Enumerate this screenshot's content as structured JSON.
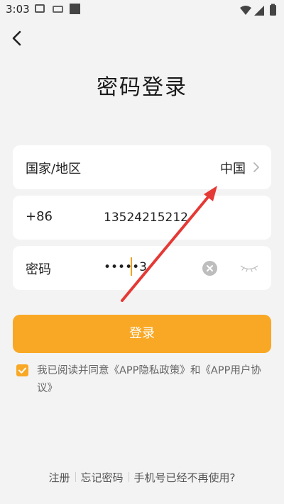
{
  "status_bar": {
    "time": "3:03"
  },
  "header": {
    "title": "密码登录"
  },
  "region": {
    "label": "国家/地区",
    "value": "中国"
  },
  "phone": {
    "code": "+86",
    "number": "13524215212"
  },
  "password": {
    "label": "密码",
    "masked_value": "•••••3"
  },
  "login_button": {
    "label": "登录"
  },
  "agreement": {
    "checked": true,
    "text": "我已阅读并同意《APP隐私政策》和《APP用户协议》"
  },
  "footer": {
    "register": "注册",
    "forgot": "忘记密码",
    "phone_unused": "手机号已经不再使用?"
  },
  "colors": {
    "accent": "#f9a825",
    "annotation_arrow": "#e53935"
  }
}
